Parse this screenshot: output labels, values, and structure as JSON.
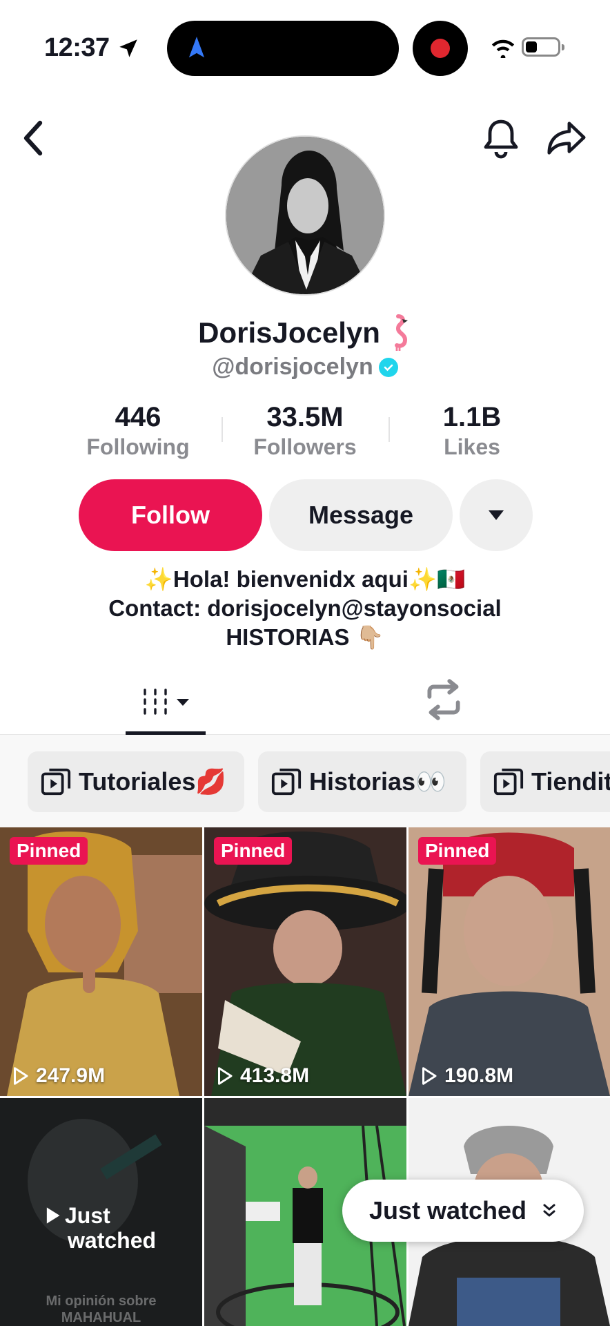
{
  "status": {
    "time": "12:37"
  },
  "profile": {
    "display_name": "DorisJocelyn",
    "handle": "@dorisjocelyn",
    "verified": true
  },
  "stats": [
    {
      "value": "446",
      "label": "Following"
    },
    {
      "value": "33.5M",
      "label": "Followers"
    },
    {
      "value": "1.1B",
      "label": "Likes"
    }
  ],
  "actions": {
    "follow": "Follow",
    "message": "Message"
  },
  "bio": {
    "line1": "✨Hola! bienvenidx aqui✨🇲🇽",
    "line2": "Contact: dorisjocelyn@stayonsocial",
    "line3": "HISTORIAS 👇🏼"
  },
  "playlists": [
    {
      "label": "Tutoriales💋"
    },
    {
      "label": "Historias👀"
    },
    {
      "label": "Tiendit"
    }
  ],
  "videos": [
    {
      "pinned": "Pinned",
      "views": "247.9M"
    },
    {
      "pinned": "Pinned",
      "views": "413.8M"
    },
    {
      "pinned": "Pinned",
      "views": "190.8M"
    },
    {
      "overlay_line1": "Just",
      "overlay_line2": "watched",
      "caption_line1": "Mi opinión sobre",
      "caption_line2": "MAHAHUAL"
    },
    {},
    {}
  ],
  "floating": {
    "just_watched": "Just watched"
  },
  "colors": {
    "accent": "#ea1452",
    "verified": "#20d5ec"
  }
}
